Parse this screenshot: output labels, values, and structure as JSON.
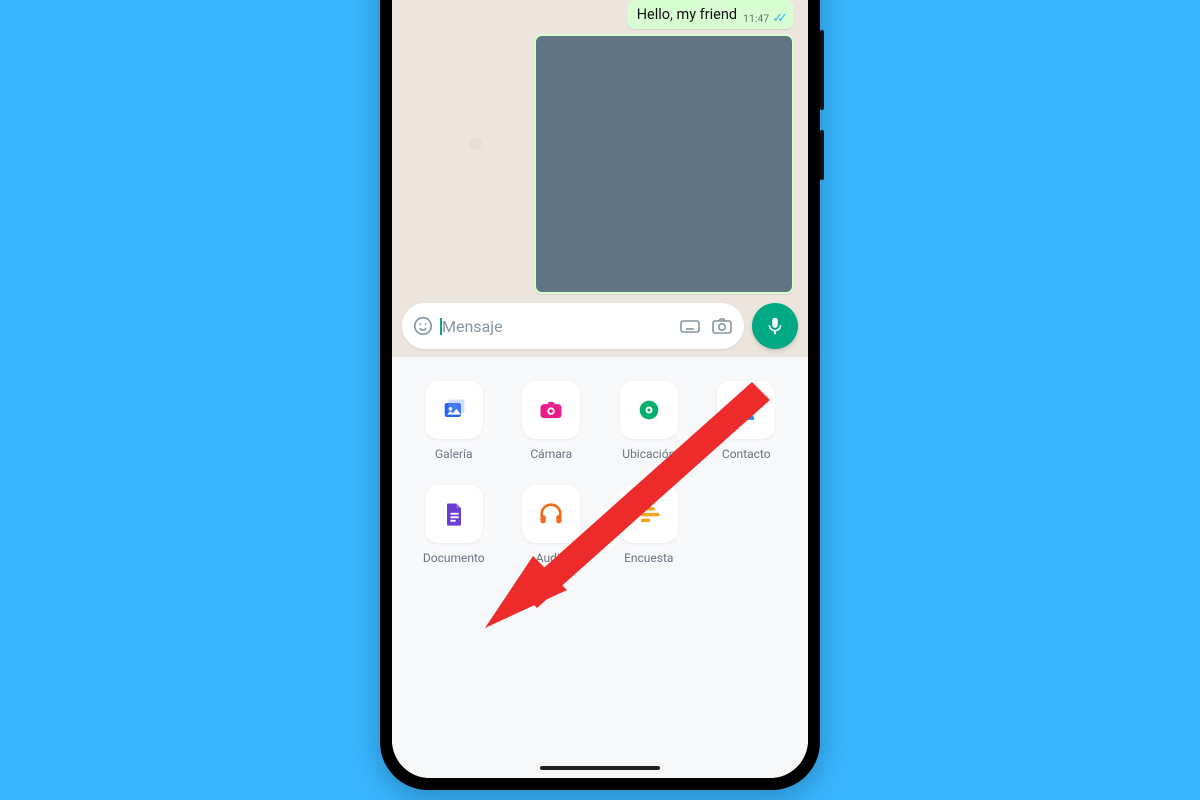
{
  "chat": {
    "message_text": "Hello, my friend",
    "message_time": "11:47"
  },
  "input": {
    "placeholder": "Mensaje"
  },
  "attachments": {
    "items": [
      {
        "label": "Galería",
        "icon": "gallery",
        "color": "#2864ec"
      },
      {
        "label": "Cámara",
        "icon": "camera",
        "color": "#e91e8c"
      },
      {
        "label": "Ubicación",
        "icon": "location",
        "color": "#06b06b"
      },
      {
        "label": "Contacto",
        "icon": "contact",
        "color": "#1e88e5"
      },
      {
        "label": "Documento",
        "icon": "document",
        "color": "#6b3fd4"
      },
      {
        "label": "Audio",
        "icon": "audio",
        "color": "#f26a1b"
      },
      {
        "label": "Encuesta",
        "icon": "poll",
        "color": "#f2a71b"
      }
    ]
  },
  "annotation": {
    "arrow_color": "#ed2b2b",
    "arrow_target": "Documento"
  }
}
